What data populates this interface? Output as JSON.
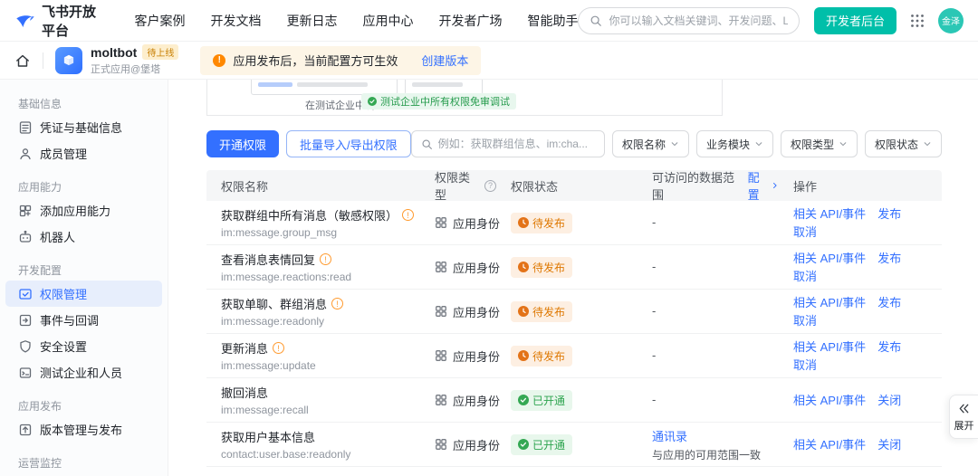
{
  "colors": {
    "accent_blue": "#3370ff",
    "teal": "#00bfa9",
    "warning_orange": "#de7802",
    "success_green": "#2ea44f"
  },
  "topnav": {
    "brand": "飞书开放平台",
    "items": [
      "客户案例",
      "开发文档",
      "更新日志",
      "应用中心",
      "开发者广场",
      "智能助手"
    ],
    "search_placeholder": "你可以输入文档关键词、开发问题、Log ID、错误码",
    "console_button": "开发者后台",
    "avatar": "金泽"
  },
  "appbar": {
    "app_name": "moltbot",
    "app_badge": "待上线",
    "app_subtitle": "正式应用@堡塔",
    "banner_text": "应用发布后，当前配置方可生效",
    "banner_link": "创建版本"
  },
  "sidebar": {
    "sections": [
      {
        "title": "基础信息",
        "items": [
          {
            "id": "credentials",
            "icon": "credential",
            "label": "凭证与基础信息"
          },
          {
            "id": "members",
            "icon": "members",
            "label": "成员管理"
          }
        ]
      },
      {
        "title": "应用能力",
        "items": [
          {
            "id": "add-capability",
            "icon": "add",
            "label": "添加应用能力"
          },
          {
            "id": "robot",
            "icon": "robot",
            "label": "机器人"
          }
        ]
      },
      {
        "title": "开发配置",
        "items": [
          {
            "id": "permissions",
            "icon": "permission",
            "label": "权限管理",
            "active": true
          },
          {
            "id": "events-callbacks",
            "icon": "events",
            "label": "事件与回调"
          },
          {
            "id": "security-settings",
            "icon": "security",
            "label": "安全设置"
          },
          {
            "id": "test-org",
            "icon": "testorg",
            "label": "测试企业和人员"
          }
        ]
      },
      {
        "title": "应用发布",
        "items": [
          {
            "id": "version-release",
            "icon": "release",
            "label": "版本管理与发布"
          }
        ]
      },
      {
        "title": "运营监控",
        "items": []
      }
    ]
  },
  "diagram": {
    "debug_label": "在测试企业中调试",
    "green_badge": "测试企业中所有权限免审调试"
  },
  "toolbar": {
    "open_permission": "开通权限",
    "batch_import_export": "批量导入/导出权限",
    "search_placeholder": "例如：获取群组信息、im:cha...",
    "filters": [
      {
        "id": "name",
        "label": "权限名称"
      },
      {
        "id": "module",
        "label": "业务模块"
      },
      {
        "id": "type",
        "label": "权限类型"
      },
      {
        "id": "status",
        "label": "权限状态"
      }
    ]
  },
  "table": {
    "headers": {
      "name": "权限名称",
      "type": "权限类型",
      "status": "权限状态",
      "scope": "可访问的数据范围",
      "scope_action": "配置",
      "actions": "操作"
    },
    "rows": [
      {
        "name": "获取群组中所有消息（敏感权限）",
        "code": "im:message.group_msg",
        "has_info": true,
        "type": "应用身份",
        "status": {
          "label": "待发布",
          "type": "pending"
        },
        "scope": {
          "text": "-"
        },
        "actions": [
          {
            "id": "related-api",
            "label": "相关 API/事件"
          },
          {
            "id": "publish",
            "label": "发布"
          },
          {
            "id": "cancel",
            "label": "取消"
          }
        ]
      },
      {
        "name": "查看消息表情回复",
        "code": "im:message.reactions:read",
        "has_info": true,
        "type": "应用身份",
        "status": {
          "label": "待发布",
          "type": "pending"
        },
        "scope": {
          "text": "-"
        },
        "actions": [
          {
            "id": "related-api",
            "label": "相关 API/事件"
          },
          {
            "id": "publish",
            "label": "发布"
          },
          {
            "id": "cancel",
            "label": "取消"
          }
        ]
      },
      {
        "name": "获取单聊、群组消息",
        "code": "im:message:readonly",
        "has_info": true,
        "type": "应用身份",
        "status": {
          "label": "待发布",
          "type": "pending"
        },
        "scope": {
          "text": "-"
        },
        "actions": [
          {
            "id": "related-api",
            "label": "相关 API/事件"
          },
          {
            "id": "publish",
            "label": "发布"
          },
          {
            "id": "cancel",
            "label": "取消"
          }
        ]
      },
      {
        "name": "更新消息",
        "code": "im:message:update",
        "has_info": true,
        "type": "应用身份",
        "status": {
          "label": "待发布",
          "type": "pending"
        },
        "scope": {
          "text": "-"
        },
        "actions": [
          {
            "id": "related-api",
            "label": "相关 API/事件"
          },
          {
            "id": "publish",
            "label": "发布"
          },
          {
            "id": "cancel",
            "label": "取消"
          }
        ]
      },
      {
        "name": "撤回消息",
        "code": "im:message:recall",
        "has_info": false,
        "type": "应用身份",
        "status": {
          "label": "已开通",
          "type": "active"
        },
        "scope": {
          "text": "-"
        },
        "actions": [
          {
            "id": "related-api",
            "label": "相关 API/事件"
          },
          {
            "id": "close",
            "label": "关闭"
          }
        ]
      },
      {
        "name": "获取用户基本信息",
        "code": "contact:user.base:readonly",
        "has_info": false,
        "type": "应用身份",
        "status": {
          "label": "已开通",
          "type": "active"
        },
        "scope": {
          "link": "通讯录",
          "text": "与应用的可用范围一致"
        },
        "actions": [
          {
            "id": "related-api",
            "label": "相关 API/事件"
          },
          {
            "id": "close",
            "label": "关闭"
          }
        ]
      }
    ]
  },
  "expand": {
    "label": "展开"
  }
}
